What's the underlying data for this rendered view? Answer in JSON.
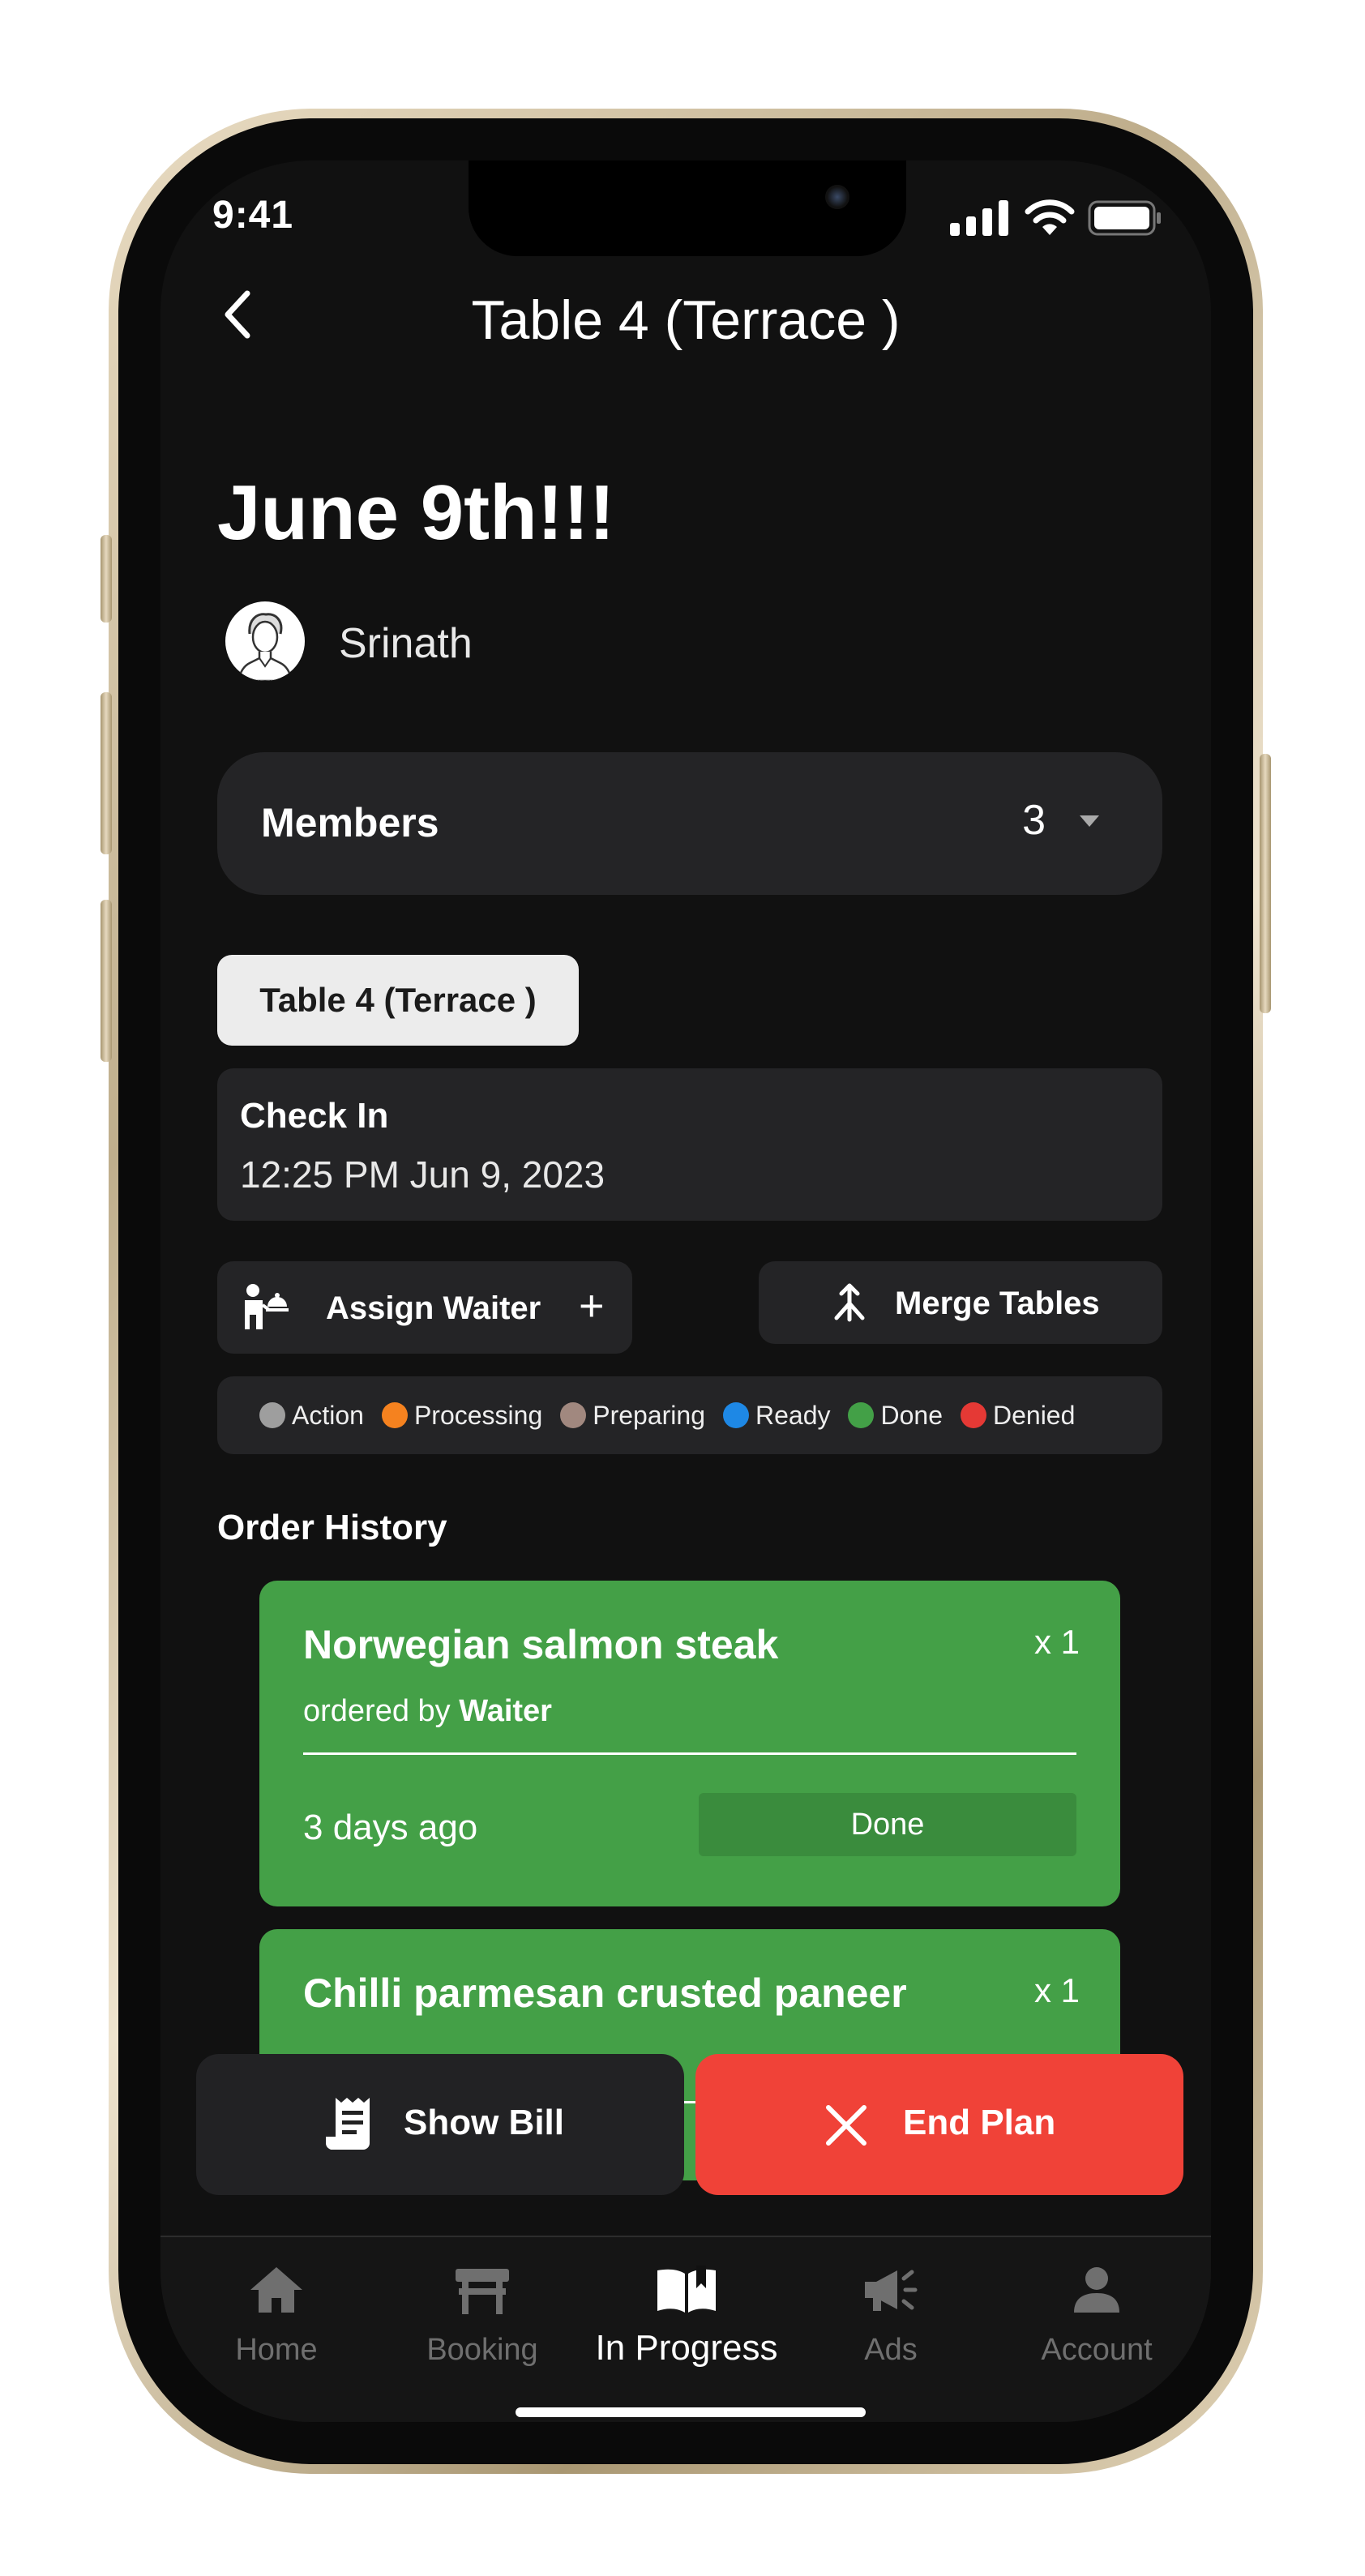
{
  "status_bar": {
    "time": "9:41"
  },
  "nav": {
    "title": "Table 4  (Terrace )"
  },
  "plan": {
    "title": "June 9th!!!",
    "host": "Srinath"
  },
  "members": {
    "label": "Members",
    "count": "3"
  },
  "table_chip": {
    "label": "Table 4  (Terrace )"
  },
  "checkin": {
    "label": "Check In",
    "time": "12:25 PM Jun 9, 2023"
  },
  "actions": {
    "assign_label": "Assign Waiter",
    "assign_plus": "+",
    "merge_label": "Merge Tables"
  },
  "legend": [
    {
      "label": "Action",
      "color": "#9e9e9e"
    },
    {
      "label": "Processing",
      "color": "#f5821f"
    },
    {
      "label": "Preparing",
      "color": "#a1887f"
    },
    {
      "label": "Ready",
      "color": "#1e88e5"
    },
    {
      "label": "Done",
      "color": "#43a047"
    },
    {
      "label": "Denied",
      "color": "#e53935"
    }
  ],
  "order_history": {
    "title": "Order History",
    "orders": [
      {
        "name": "Norwegian salmon steak",
        "qty": "x 1",
        "ordered_by_prefix": "ordered by",
        "ordered_by": "Waiter",
        "time": "3 days ago",
        "status": "Done"
      },
      {
        "name": "Chilli parmesan crusted paneer",
        "qty": "x 1"
      }
    ]
  },
  "bottom_actions": {
    "show_bill": "Show Bill",
    "end_plan": "End Plan"
  },
  "tabbar": {
    "tabs": [
      {
        "label": "Home",
        "icon": "home-icon"
      },
      {
        "label": "Booking",
        "icon": "table-icon"
      },
      {
        "label": "In Progress",
        "icon": "book-icon",
        "active": true
      },
      {
        "label": "Ads",
        "icon": "megaphone-icon"
      },
      {
        "label": "Account",
        "icon": "person-icon"
      }
    ]
  }
}
